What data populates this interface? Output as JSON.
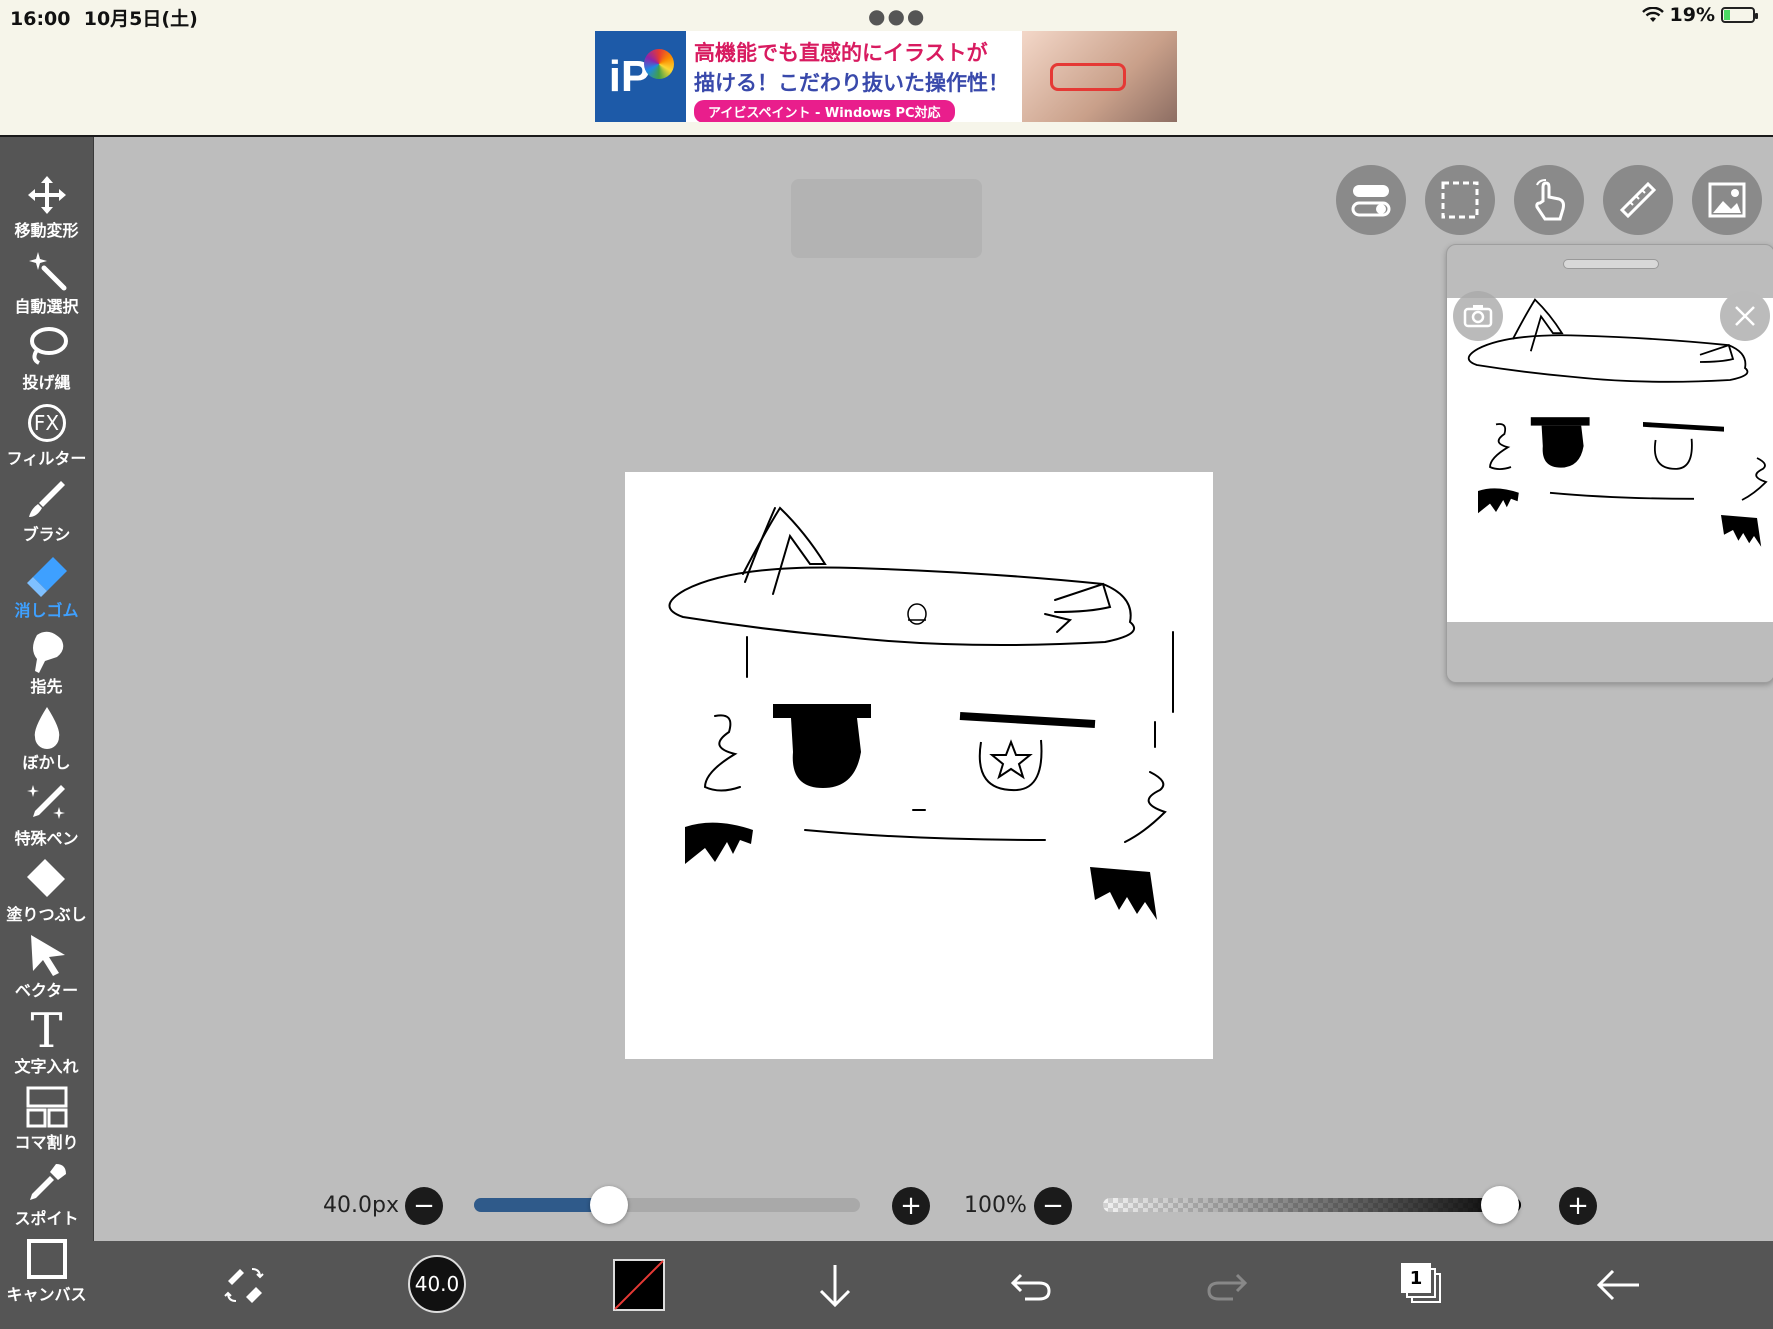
{
  "status": {
    "time": "16:00",
    "date": "10月5日(土)",
    "battery": "19%"
  },
  "ad": {
    "line1": "高機能でも直感的にイラストが",
    "line2": "描ける！こだわり抜いた操作性！",
    "pill": "アイビスペイント - Windows PC対応",
    "logo_text": "iP"
  },
  "tools": [
    {
      "label": "移動変形",
      "icon": "move-icon"
    },
    {
      "label": "自動選択",
      "icon": "magic-wand-icon"
    },
    {
      "label": "投げ縄",
      "icon": "lasso-icon"
    },
    {
      "label": "フィルター",
      "icon": "fx-icon"
    },
    {
      "label": "ブラシ",
      "icon": "brush-icon"
    },
    {
      "label": "消しゴム",
      "icon": "eraser-icon",
      "active": true
    },
    {
      "label": "指先",
      "icon": "finger-icon"
    },
    {
      "label": "ぼかし",
      "icon": "blur-drop-icon"
    },
    {
      "label": "特殊ペン",
      "icon": "special-pen-icon"
    },
    {
      "label": "塗りつぶし",
      "icon": "fill-icon"
    },
    {
      "label": "ベクター",
      "icon": "vector-icon"
    },
    {
      "label": "文字入れ",
      "icon": "text-icon"
    },
    {
      "label": "コマ割り",
      "icon": "frame-divider-icon"
    },
    {
      "label": "スポイト",
      "icon": "eyedropper-icon"
    },
    {
      "label": "キャンバス",
      "icon": "canvas-icon"
    }
  ],
  "fx_text": "FX",
  "text_tool_glyph": "T",
  "sliders": {
    "size_label": "40.0px",
    "size_fraction": 0.35,
    "opacity_label": "100%",
    "opacity_fraction": 1.0
  },
  "bottom": {
    "brush_size": "40.0",
    "layer_count": "1"
  },
  "colors": {
    "toolbar": "#555555",
    "active_tool": "#3ea0ff",
    "slider_fill": "#2f5a8a",
    "ad_pink": "#e91e8c"
  }
}
